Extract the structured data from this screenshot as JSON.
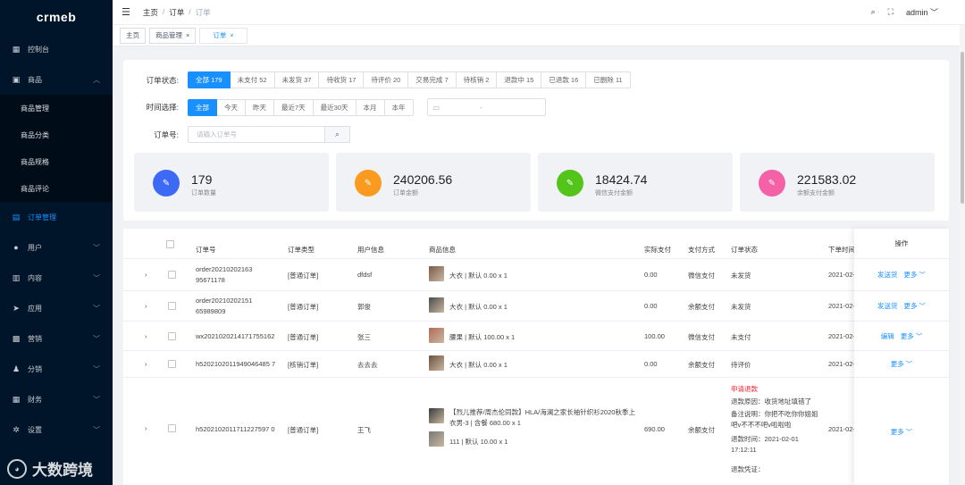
{
  "logo": "crmeb",
  "sidebar": {
    "items": [
      {
        "label": "控制台",
        "icon": "dashboard-icon"
      },
      {
        "label": "商品",
        "icon": "goods-icon",
        "expanded": true
      },
      {
        "label": "商品管理"
      },
      {
        "label": "商品分类"
      },
      {
        "label": "商品规格"
      },
      {
        "label": "商品评论"
      },
      {
        "label": "订单管理",
        "icon": "order-icon",
        "active": true
      },
      {
        "label": "用户",
        "icon": "user-icon"
      },
      {
        "label": "内容",
        "icon": "content-icon"
      },
      {
        "label": "应用",
        "icon": "app-icon"
      },
      {
        "label": "营销",
        "icon": "marketing-icon"
      },
      {
        "label": "分销",
        "icon": "distribution-icon"
      },
      {
        "label": "财务",
        "icon": "finance-icon"
      },
      {
        "label": "设置",
        "icon": "settings-icon"
      }
    ]
  },
  "watermark": "大数跨境",
  "header": {
    "breadcrumb": [
      "主页",
      "订单",
      "订单"
    ],
    "user": "admin"
  },
  "tags": [
    {
      "label": "主页"
    },
    {
      "label": "商品管理"
    },
    {
      "label": "订单"
    }
  ],
  "filters": {
    "status_label": "订单状态:",
    "status_options": [
      "全部 179",
      "未支付 52",
      "未发货 37",
      "待收货 17",
      "待评价 20",
      "交易完成 7",
      "待核销 2",
      "退款中 15",
      "已退款 16",
      "已删除 11"
    ],
    "time_label": "时间选择:",
    "time_options": [
      "全部",
      "今天",
      "昨天",
      "最近7天",
      "最近30天",
      "本月",
      "本年"
    ],
    "date_sep": "-",
    "order_label": "订单号:",
    "order_placeholder": "请输入订单号"
  },
  "stats": [
    {
      "value": "179",
      "label": "订单数量",
      "color": "#3d6af5"
    },
    {
      "value": "240206.56",
      "label": "订单金额",
      "color": "#fa9a1e"
    },
    {
      "value": "18424.74",
      "label": "微信支付金额",
      "color": "#52c41a"
    },
    {
      "value": "221583.02",
      "label": "余额支付金额",
      "color": "#f561a6"
    }
  ],
  "table": {
    "headers": [
      "订单号",
      "订单类型",
      "用户信息",
      "商品信息",
      "实际支付",
      "支付方式",
      "订单状态",
      "下单时间",
      "操作"
    ],
    "rows": [
      {
        "order": "order2021020216395671178",
        "type": "[普通订单]",
        "user": "dfdsf",
        "goods": "大衣 | 默认   0.00 x 1",
        "pay": "0.00",
        "method": "微信支付",
        "status": "未发货",
        "time": "2021-02-0",
        "actions": [
          "发送货",
          "更多"
        ]
      },
      {
        "order": "order2021020215165989809",
        "type": "[普通订单]",
        "user": "郭俊",
        "goods": "大衣 | 默认   0.00 x 1",
        "pay": "0.00",
        "method": "余额支付",
        "status": "未发货",
        "time": "2021-02-0",
        "actions": [
          "发送货",
          "更多"
        ]
      },
      {
        "order": "wx2021020214171755162",
        "type": "[普通订单]",
        "user": "张三",
        "goods": "腰果 | 默认   100.00 x 1",
        "pay": "100.00",
        "method": "微信支付",
        "status": "未支付",
        "time": "2021-02-0",
        "actions": [
          "编辑",
          "更多"
        ]
      },
      {
        "order": "h5202102011949046485 7",
        "type": "[核销订单]",
        "user": "去去去",
        "goods": "大衣 | 默认   0.00 x 1",
        "pay": "0.00",
        "method": "余额支付",
        "status": "待评价",
        "time": "2021-02-0",
        "actions": [
          "更多"
        ]
      },
      {
        "order": "h5202102011711227597 0",
        "type": "[普通订单]",
        "user": "王飞",
        "goods": "【烈儿推荐/周杰伦同款】HLA/海澜之家长袖针织衫2020秋季上衣男-3 | 含餐   680.00 x 1",
        "goods2": "111 | 默认   10.00 x 1",
        "pay": "690.00",
        "method": "余额支付",
        "status_title": "申请退款",
        "status_lines": [
          "退款原因：收货地址填错了",
          "备注说明：你把不吃你你姐姐吧v不不不吧v啦啦啦",
          "退款时间：2021-02-01 17:12:11",
          "退款凭证："
        ],
        "time": "2021-02-0",
        "actions": [
          "更多"
        ]
      }
    ]
  }
}
